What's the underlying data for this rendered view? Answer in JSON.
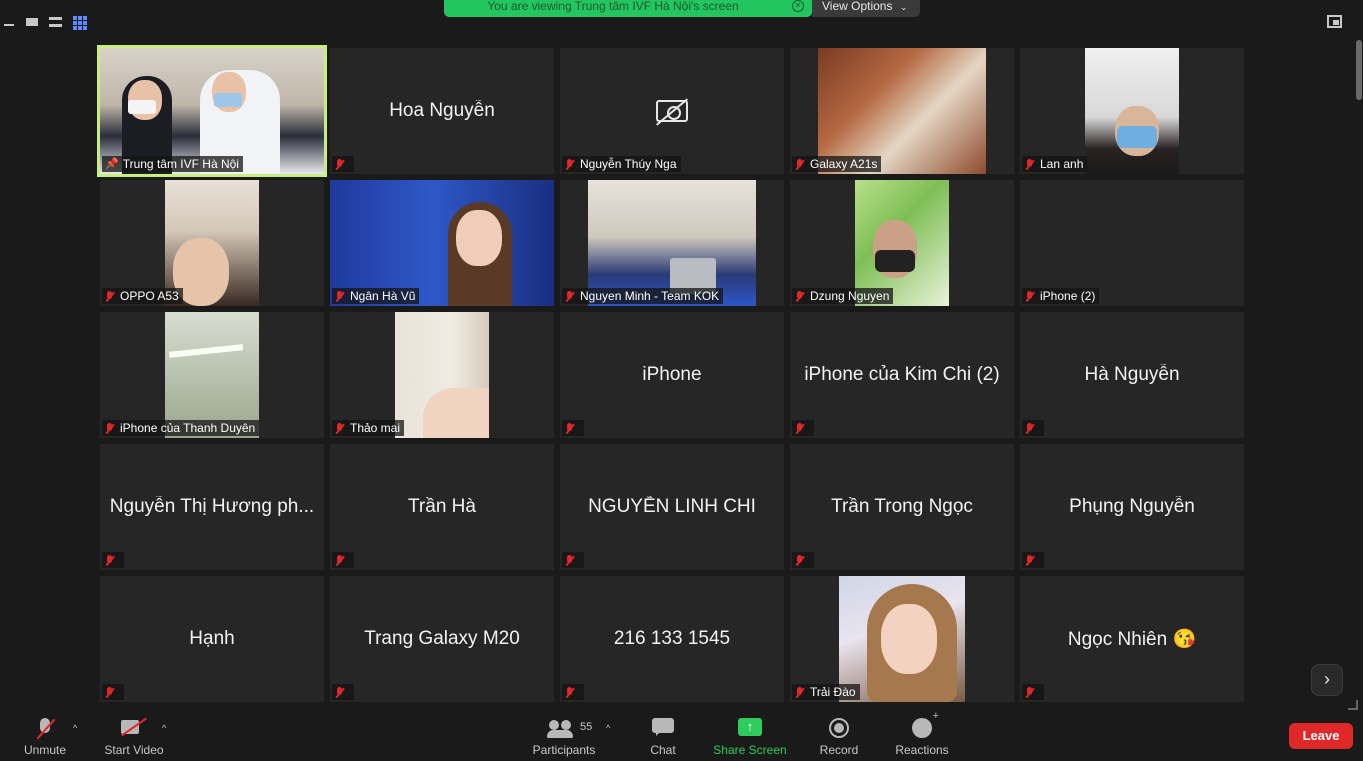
{
  "banner": {
    "share_text": "You are viewing Trung tâm IVF Hà Nội's screen",
    "view_options": "View Options"
  },
  "tiles": [
    {
      "name": "Trung tâm IVF Hà Nội",
      "video": "ivf",
      "pinned": true
    },
    {
      "name": "Hoa Nguyễn",
      "video": "none"
    },
    {
      "name": "Nguyễn Thúy Nga",
      "video": "camoff"
    },
    {
      "name": "Galaxy A21s",
      "video": "room"
    },
    {
      "name": "Lan anh",
      "video": "lan"
    },
    {
      "name": "OPPO A53",
      "video": "oppo"
    },
    {
      "name": "Ngân Hà Vũ",
      "video": "ngan"
    },
    {
      "name": "Nguyen Minh - Team KOK",
      "video": "kok"
    },
    {
      "name": "Dzung Nguyen",
      "video": "dzung"
    },
    {
      "name": "iPhone (2)",
      "video": "blank"
    },
    {
      "name": "iPhone của Thanh Duyên",
      "video": "ceiling"
    },
    {
      "name": "Thảo mai",
      "video": "thao"
    },
    {
      "name": "iPhone",
      "video": "none"
    },
    {
      "name": "iPhone của Kim Chi (2)",
      "video": "none"
    },
    {
      "name": "Hà Nguyễn",
      "video": "none"
    },
    {
      "name": "Nguyễn Thị Hương ph...",
      "video": "none"
    },
    {
      "name": "Trần Hà",
      "video": "none"
    },
    {
      "name": "NGUYỄN LINH CHI",
      "video": "none"
    },
    {
      "name": "Trần Trong Ngọc",
      "video": "none"
    },
    {
      "name": "Phụng Nguyễn",
      "video": "none"
    },
    {
      "name": "Hạnh",
      "video": "none"
    },
    {
      "name": "Trang Galaxy M20",
      "video": "none"
    },
    {
      "name": "216 133 1545",
      "video": "none"
    },
    {
      "name": "Trải Đào",
      "video": "trai"
    },
    {
      "name": "Ngọc Nhiên 😘",
      "video": "none"
    }
  ],
  "toolbar": {
    "unmute": "Unmute",
    "start_video": "Start Video",
    "participants": "Participants",
    "participant_count": "55",
    "chat": "Chat",
    "share_screen": "Share Screen",
    "record": "Record",
    "reactions": "Reactions",
    "leave": "Leave"
  },
  "colors": {
    "banner_green": "#23c55e",
    "pinned_outline": "#c9ee80",
    "muted_red": "#e02828",
    "leave_red": "#e02828",
    "share_green": "#2ecc5c"
  },
  "icons": {
    "next_page": "chevron-right-icon",
    "stop_share": "stop-share-icon"
  }
}
